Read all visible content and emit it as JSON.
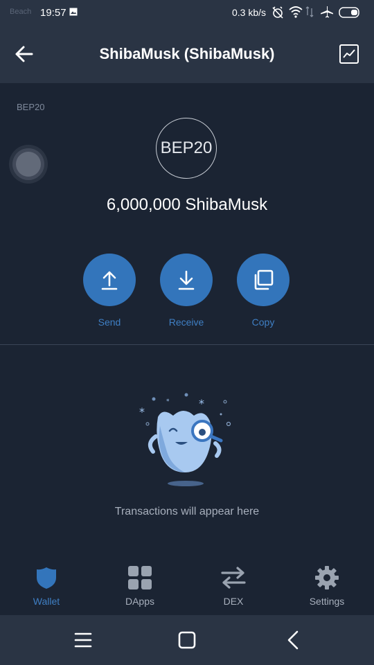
{
  "status_bar": {
    "carrier": "Beach",
    "time": "19:57",
    "network_speed": "0.3 kb/s"
  },
  "header": {
    "title": "ShibaMusk (ShibaMusk)"
  },
  "token": {
    "network_tag": "BEP20",
    "logo_text": "BEP20",
    "balance": "6,000,000 ShibaMusk"
  },
  "actions": [
    {
      "label": "Send",
      "icon": "upload-arrow-icon"
    },
    {
      "label": "Receive",
      "icon": "download-arrow-icon"
    },
    {
      "label": "Copy",
      "icon": "copy-icon"
    }
  ],
  "empty_state": {
    "message": "Transactions will appear here"
  },
  "tabs": [
    {
      "label": "Wallet",
      "icon": "shield-icon",
      "active": true
    },
    {
      "label": "DApps",
      "icon": "grid-icon",
      "active": false
    },
    {
      "label": "DEX",
      "icon": "swap-arrows-icon",
      "active": false
    },
    {
      "label": "Settings",
      "icon": "gear-icon",
      "active": false
    }
  ],
  "colors": {
    "background": "#1b2433",
    "bar": "#2a3444",
    "accent": "#3375bb",
    "accent_text": "#3f7fc4",
    "muted_text": "#a8b0bd"
  }
}
